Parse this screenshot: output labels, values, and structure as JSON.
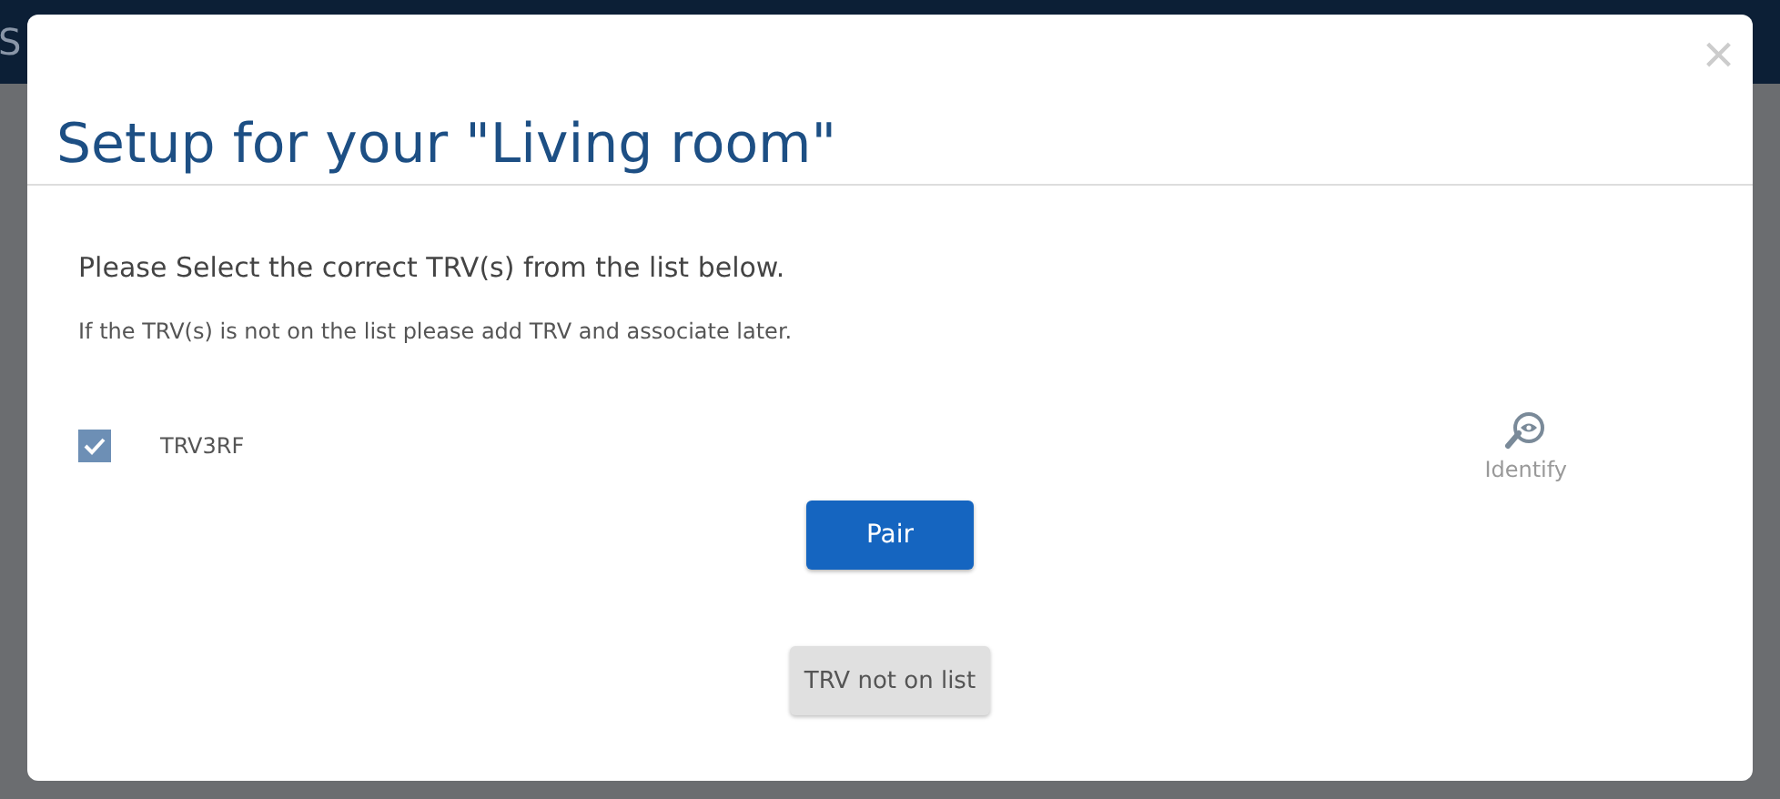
{
  "background": {
    "header_text": "S"
  },
  "dialog": {
    "title": "Setup for your \"Living room\"",
    "close": "×",
    "instruction": "Please Select the correct TRV(s) from the list below.",
    "hint": "If the TRV(s) is not on the list please add TRV and associate later.",
    "devices": [
      {
        "name": "TRV3RF",
        "checked": true,
        "action": "Identify"
      }
    ],
    "primary_button": "Pair",
    "secondary_button": "TRV not on list"
  }
}
